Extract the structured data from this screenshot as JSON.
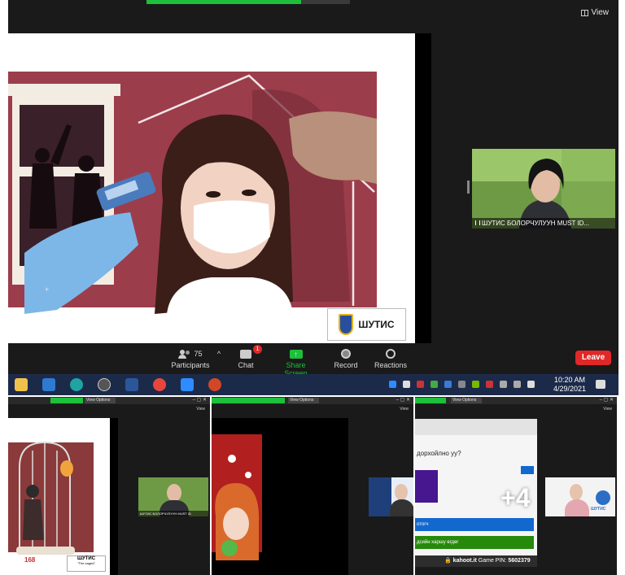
{
  "main": {
    "view_label": "View",
    "speaker_name": "ШУТИС БОЛОРЧУЛУУН MUST ID...",
    "logo_text": "ШУТИС"
  },
  "toolbar": {
    "participants_count": "75",
    "participants_label": "Participants",
    "chat_label": "Chat",
    "chat_badge": "1",
    "share_label": "Share Screen",
    "record_label": "Record",
    "reactions_label": "Reactions",
    "leave_label": "Leave"
  },
  "taskbar": {
    "time": "10:20 AM",
    "date": "4/29/2021"
  },
  "thumbs": [
    {
      "view_options": "View Options",
      "view_label": "View",
      "slide_number": "168",
      "logo_text": "ШУТИС",
      "logo_caption": "\"The caged\"",
      "speaker_name": "ШУТИС БОЛОРЧУЛУУН MUST ID"
    },
    {
      "view_options": "View Options",
      "view_label": "View",
      "speaker_name": ""
    },
    {
      "view_options": "View Options",
      "view_label": "View",
      "question": "дорхойлно уу?",
      "answer1": "отогч",
      "answer2": "дсийн харшу өгдөг",
      "kahoot": "kahoot.it",
      "game_pin_label": "Game PIN:",
      "game_pin": "5602379",
      "more_count": "+4",
      "speaker_name": "ШУТИС"
    }
  ]
}
